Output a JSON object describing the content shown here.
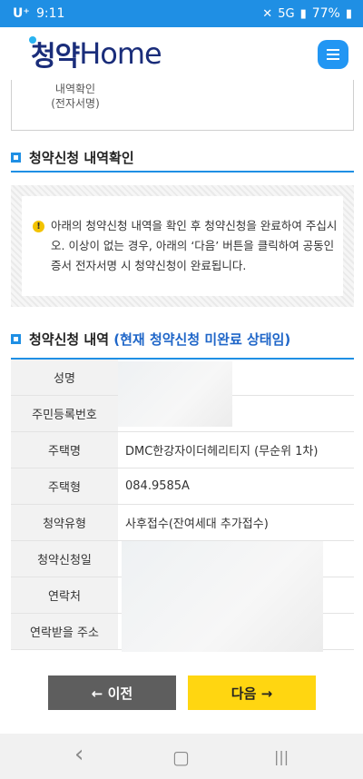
{
  "status_bar": {
    "carrier": "U⁺",
    "time": "9:11",
    "network": "5G",
    "battery": "77%"
  },
  "header": {
    "logo_ko": "청약",
    "logo_en": "Home"
  },
  "prev_box": {
    "lines": [
      "내역확인",
      "(전자서명)"
    ]
  },
  "section1": {
    "title": "청약신청 내역확인"
  },
  "notice": {
    "icon": "!",
    "message": "아래의 청약신청 내역을 확인 후 청약신청을 완료하여 주십시오. 이상이 없는 경우, 아래의 ‘다음’ 버튼을 클릭하여 공동인증서 전자서명 시 청약신청이 완료됩니다."
  },
  "section2": {
    "title": "청약신청 내역",
    "subtitle": "(현재 청약신청 미완료 상태임)"
  },
  "table": {
    "rows": [
      {
        "label": "성명",
        "value": ""
      },
      {
        "label": "주민등록번호",
        "value": ""
      },
      {
        "label": "주택명",
        "value": "DMC한강자이더헤리티지 (무순위 1차)"
      },
      {
        "label": "주택형",
        "value": "084.9585A"
      },
      {
        "label": "청약유형",
        "value": "사후접수(잔여세대 추가접수)"
      },
      {
        "label": "청약신청일",
        "value": ""
      },
      {
        "label": "연락처",
        "value": ""
      },
      {
        "label": "연락받을 주소",
        "value": ""
      }
    ]
  },
  "buttons": {
    "prev": "← 이전",
    "next": "다음 →"
  },
  "navbar": {
    "back": "‹",
    "home": "▢",
    "recents": "|||"
  }
}
